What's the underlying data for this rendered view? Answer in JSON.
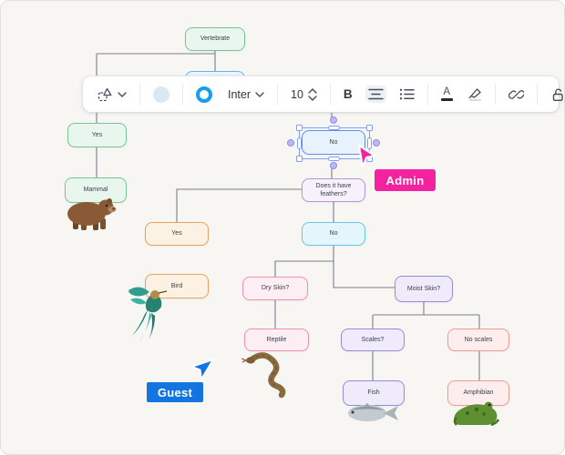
{
  "toolbar": {
    "shape_tool": "shape-picker",
    "fill_swatch_color": "#d9e9f4",
    "stroke_swatch_color": "#169df2",
    "font_name": "Inter",
    "font_size": "10",
    "bold_label": "B",
    "text_color_label": "A",
    "icons": [
      "shape-picker-icon",
      "chevron-down-icon",
      "fill-swatch",
      "stroke-swatch",
      "font-stepper-icon",
      "bold",
      "align-center-icon",
      "list-icon",
      "text-color-icon",
      "highlighter-icon",
      "link-icon",
      "unlock-icon"
    ],
    "active_tool": "align-center"
  },
  "flowchart": {
    "nodes": {
      "vertebrate": {
        "label": "Vertebrate",
        "color": "green"
      },
      "hidden_blue": {
        "label": "",
        "color": "blue"
      },
      "yes_left": {
        "label": "Yes",
        "color": "green"
      },
      "mammal": {
        "label": "Mammal",
        "color": "green"
      },
      "no_selected": {
        "label": "No",
        "color": "blue",
        "selected": true
      },
      "does_it": {
        "label": "Does it have feathers?",
        "color": "lavender"
      },
      "yes_orange": {
        "label": "Yes",
        "color": "orange"
      },
      "bird": {
        "label": "Bird",
        "color": "orange"
      },
      "no_cyan": {
        "label": "No",
        "color": "cyan"
      },
      "dry_skin": {
        "label": "Dry Skin?",
        "color": "pink"
      },
      "moist_skin": {
        "label": "Moist Skin?",
        "color": "purple"
      },
      "reptile": {
        "label": "Reptile",
        "color": "pink"
      },
      "scales": {
        "label": "Scales?",
        "color": "purple"
      },
      "no_scales": {
        "label": "No scales",
        "color": "salmon"
      },
      "fish": {
        "label": "Fish",
        "color": "purple"
      },
      "amphibian": {
        "label": "Amphibian",
        "color": "salmon"
      }
    },
    "images": [
      "bear",
      "bird",
      "snake",
      "fish",
      "frog"
    ]
  },
  "collaborators": {
    "admin": {
      "name": "Admin",
      "color": "#f3229e"
    },
    "guest": {
      "name": "Guest",
      "color": "#1375e0"
    }
  },
  "palette": {
    "canvas_bg": "#f7f6f3",
    "connector": "#787f8a",
    "node_green_border": "#77c596",
    "node_orange_border": "#e7a25f",
    "node_cyan_border": "#64c8e6",
    "node_pink_border": "#ef8fb3",
    "node_purple_border": "#9c87df",
    "node_salmon_border": "#f09a92",
    "selection_blue": "#7ba1f5"
  }
}
